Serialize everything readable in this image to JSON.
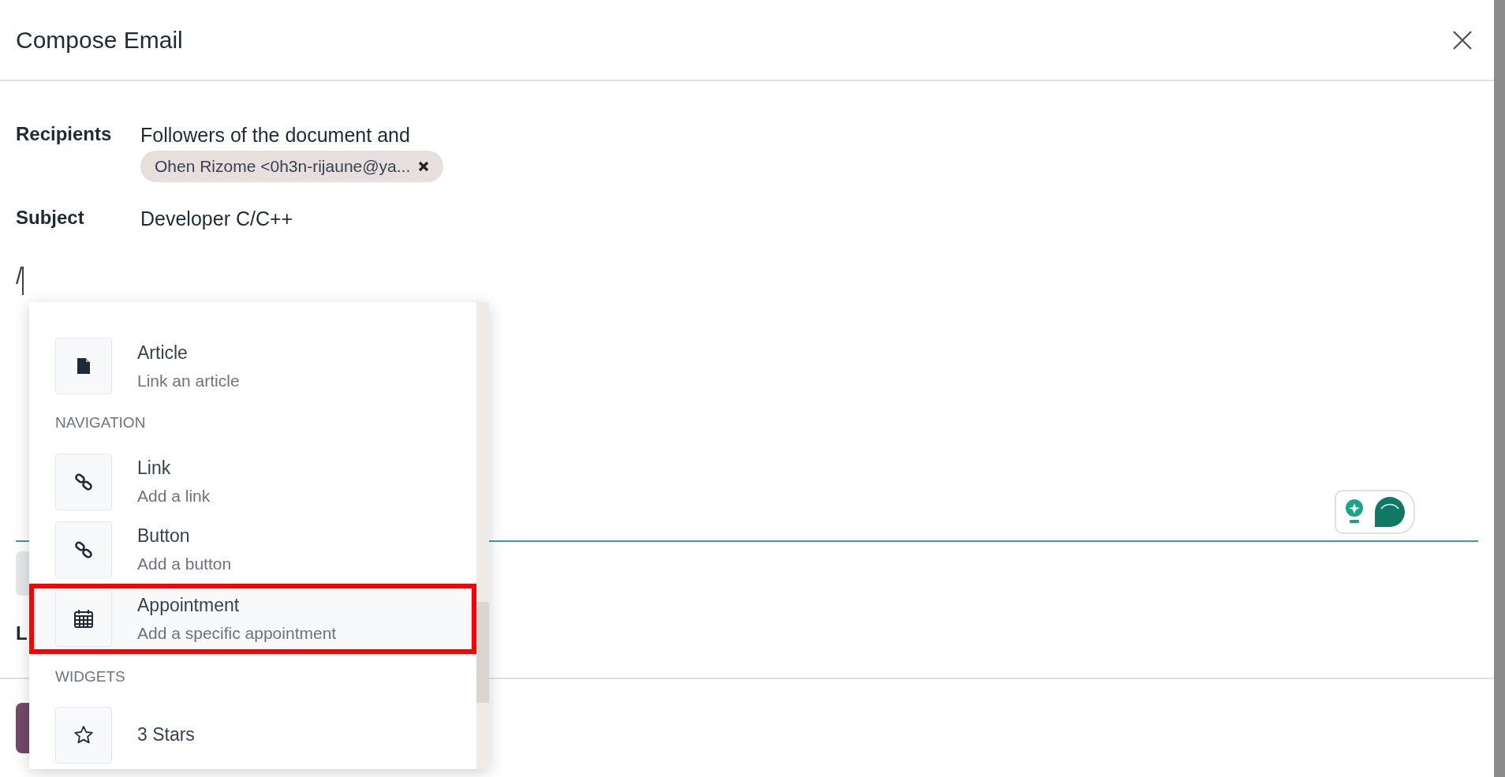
{
  "dialog": {
    "title": "Compose Email"
  },
  "fields": [
    {
      "label": "Recipients",
      "value": "Followers of the document and",
      "tags": [
        "Ohen Rizome <0h3n-rijaune@ya..."
      ]
    },
    {
      "label": "Subject",
      "value": "Developer C/C++"
    }
  ],
  "editor": {
    "content": "/"
  },
  "hidden_label": "L",
  "command_menu": {
    "items": [
      {
        "kind": "command",
        "title": "Article",
        "description": "Link an article",
        "selected": false
      },
      {
        "kind": "header",
        "title": "NAVIGATION"
      },
      {
        "kind": "command",
        "title": "Link",
        "description": "Add a link",
        "selected": false
      },
      {
        "kind": "command",
        "title": "Button",
        "description": "Add a button",
        "selected": false
      },
      {
        "kind": "command",
        "title": "Appointment",
        "description": "Add a specific appointment",
        "selected": true
      },
      {
        "kind": "header",
        "title": "WIDGETS"
      },
      {
        "kind": "command",
        "title": "3 Stars",
        "selected": false
      }
    ]
  }
}
